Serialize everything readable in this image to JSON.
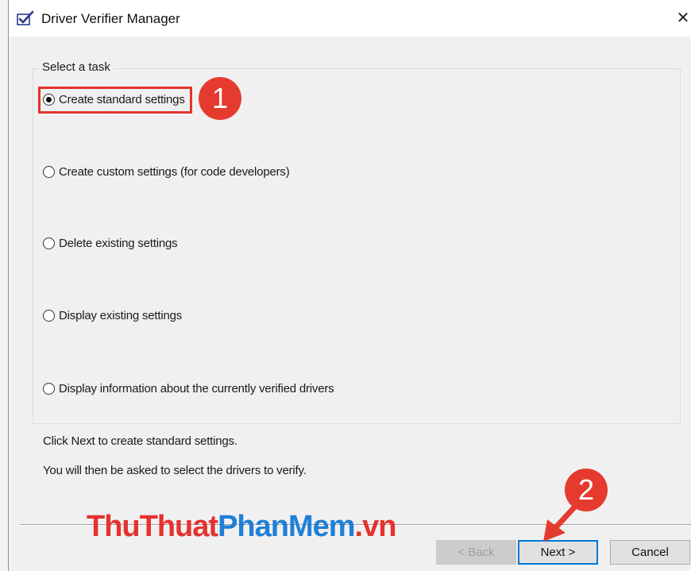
{
  "window": {
    "title": "Driver Verifier Manager",
    "close_glyph": "✕",
    "icon": "driver-verifier-checklist-icon"
  },
  "task_group": {
    "label": "Select a task",
    "options": [
      {
        "label": "Create standard settings",
        "selected": true
      },
      {
        "label": "Create custom settings (for code developers)",
        "selected": false
      },
      {
        "label": "Delete existing settings",
        "selected": false
      },
      {
        "label": "Display existing settings",
        "selected": false
      },
      {
        "label": "Display information about the currently verified drivers",
        "selected": false
      }
    ]
  },
  "info": {
    "line1": "Click Next to create standard settings.",
    "line2": "You will then be asked to select the drivers to verify."
  },
  "buttons": {
    "back": "< Back",
    "next": "Next >",
    "cancel": "Cancel"
  },
  "annotations": {
    "step1": "1",
    "step2": "2",
    "color": "#e53b2f"
  },
  "watermark": {
    "part1": "ThuThuat",
    "part2": "PhanMem",
    "part3": ".vn"
  }
}
